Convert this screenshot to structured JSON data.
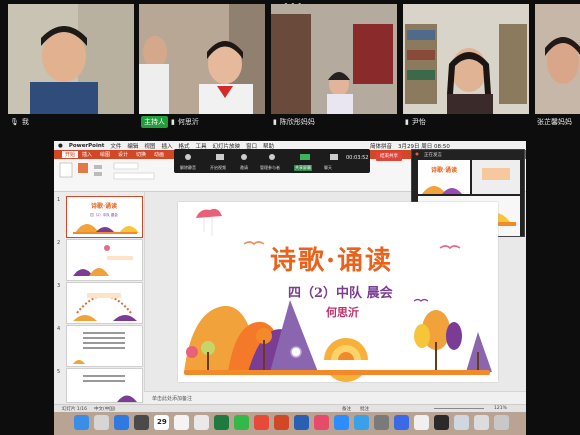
{
  "participants": [
    {
      "name": "我",
      "host_badge": ""
    },
    {
      "name": "何思沂",
      "host_badge": "主持人"
    },
    {
      "name": "陈欣彤妈妈",
      "host_badge": ""
    },
    {
      "name": "尹怡",
      "host_badge": ""
    },
    {
      "name": "张芷馨妈妈",
      "host_badge": ""
    }
  ],
  "mac_menu": {
    "app": "PowerPoint",
    "items": [
      "文件",
      "编辑",
      "视图",
      "插入",
      "格式",
      "工具",
      "幻灯片放映",
      "窗口",
      "帮助"
    ],
    "clock": "3月29日 周日 08:50",
    "input_method": "简体拼音"
  },
  "ribbon_tabs": [
    "开始",
    "插入",
    "绘图",
    "设计",
    "切换",
    "动画"
  ],
  "meeting_bar": {
    "buttons": [
      "解除静音",
      "开启视频",
      "邀请",
      "管理参与者",
      "共享屏幕",
      "聊天"
    ],
    "timer": "00:03:52",
    "end": "结束共享"
  },
  "pip_label": "正在发言",
  "slide": {
    "title": "诗歌·诵读",
    "subtitle": "四（2）中队 晨会",
    "presenter": "何思沂"
  },
  "thumb_numbers": [
    "1",
    "2",
    "3",
    "4",
    "5"
  ],
  "notes_placeholder": "单击此处添加备注",
  "status": {
    "slide_count": "幻灯片 1/16",
    "language": "中文(中国)",
    "notes_btn": "备注",
    "comments_btn": "批注",
    "zoom": "121%"
  },
  "dock": {
    "calendar_day": "29"
  },
  "colors": {
    "ppt_accent": "#d24726",
    "host_badge": "#1f9e3a",
    "title_orange": "#e8641e",
    "subtitle_purple": "#7a3c94"
  }
}
